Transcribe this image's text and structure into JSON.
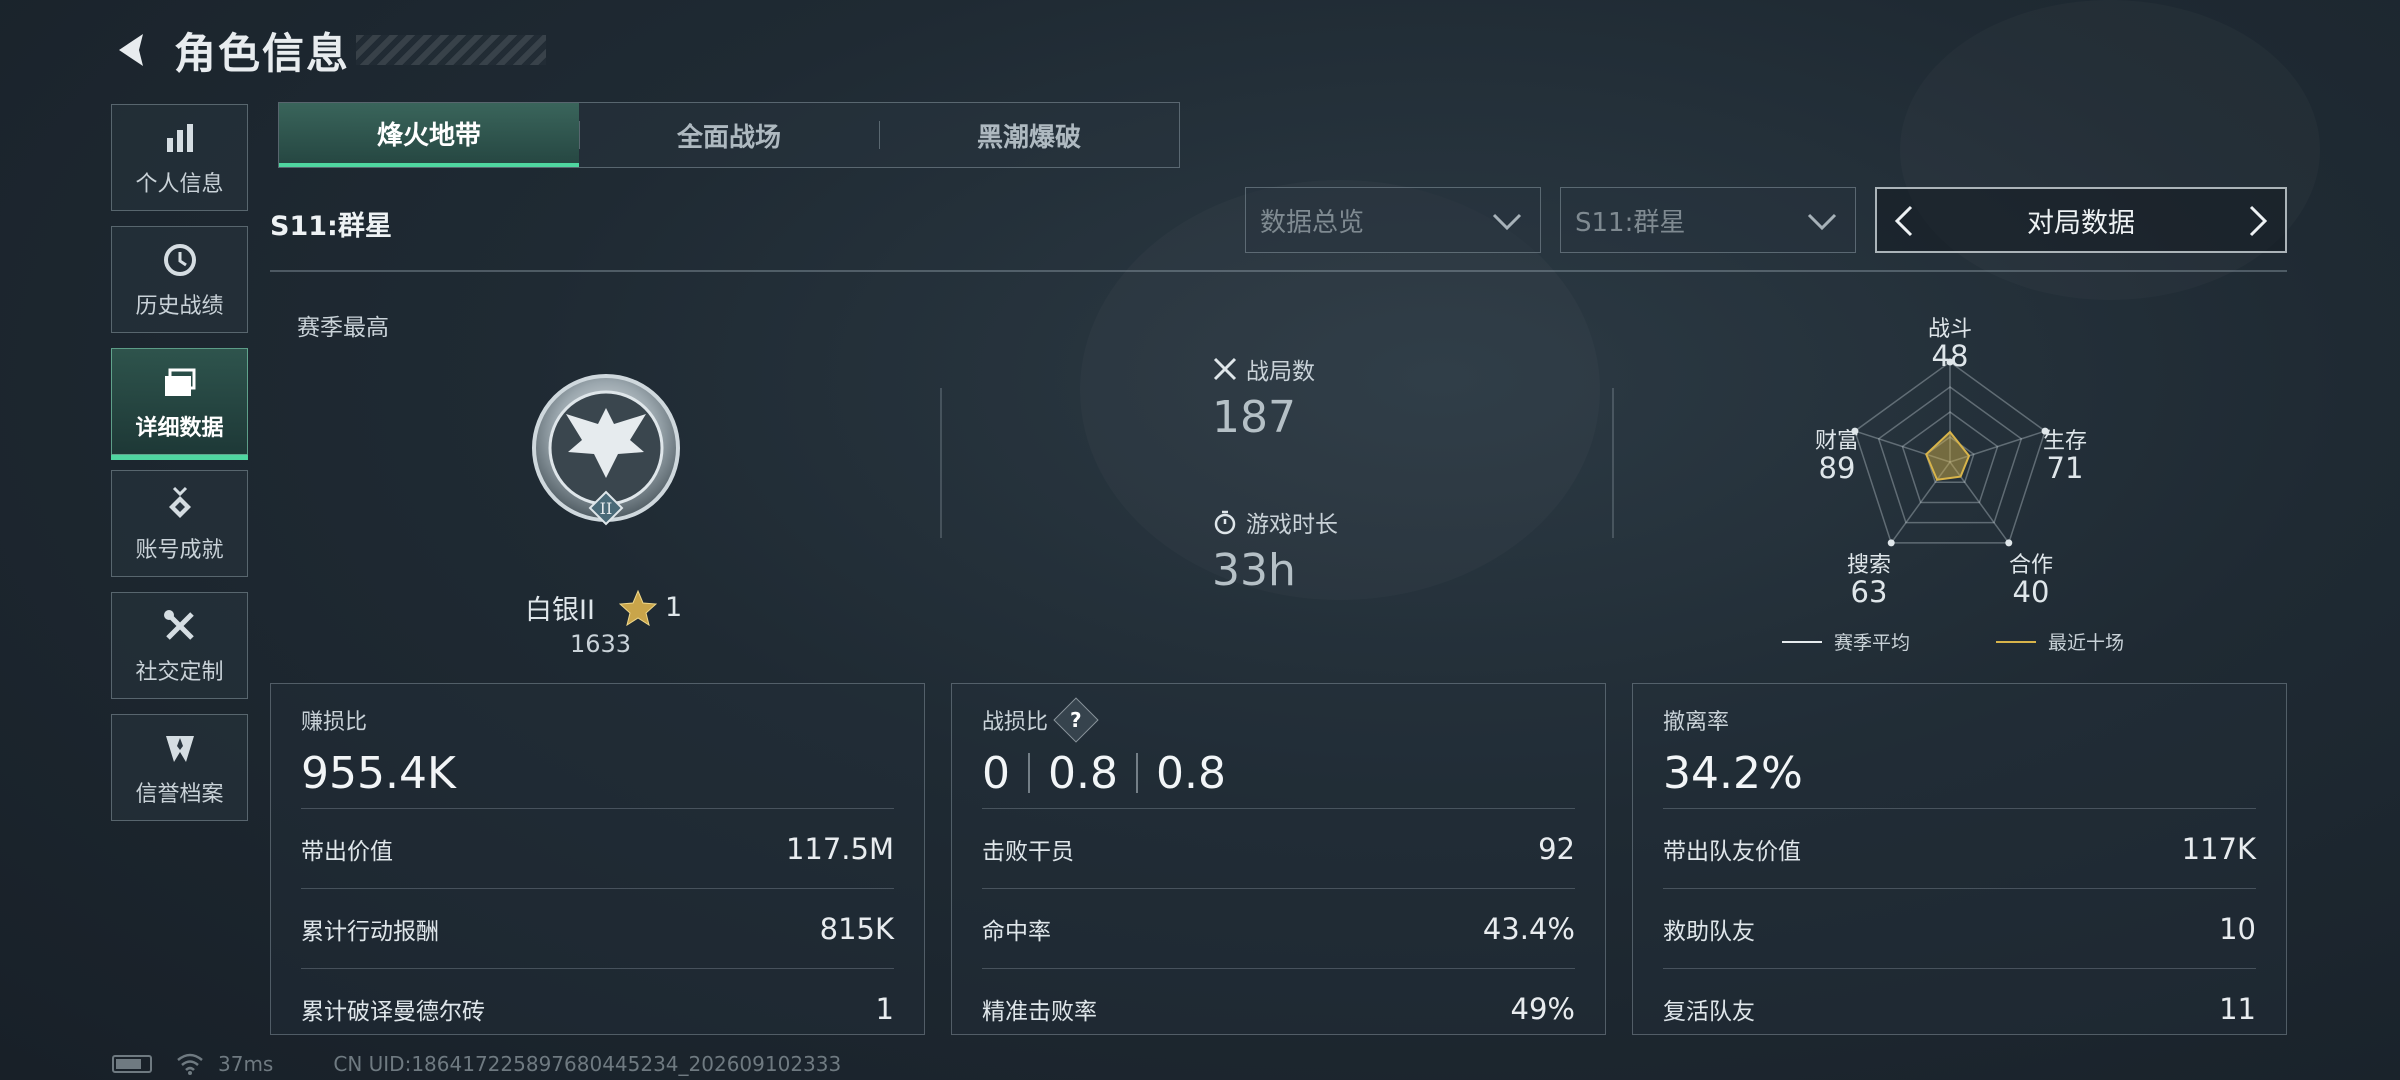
{
  "header": {
    "title": "角色信息"
  },
  "sidebar": {
    "items": [
      {
        "label": "个人信息",
        "icon": "bar-chart-icon",
        "active": false
      },
      {
        "label": "历史战绩",
        "icon": "history-clock-icon",
        "active": false
      },
      {
        "label": "详细数据",
        "icon": "folder-icon",
        "active": true
      },
      {
        "label": "账号成就",
        "icon": "medal-icon",
        "active": false
      },
      {
        "label": "社交定制",
        "icon": "tools-icon",
        "active": false
      },
      {
        "label": "信誉档案",
        "icon": "shield-emblem-icon",
        "active": false
      }
    ]
  },
  "tabs": [
    {
      "label": "烽火地带",
      "active": true
    },
    {
      "label": "全面战场",
      "active": false
    },
    {
      "label": "黑潮爆破",
      "active": false
    }
  ],
  "season_label": "S11:群星",
  "filters": {
    "overview_dropdown": "数据总览",
    "season_dropdown": "S11:群星",
    "switcher_label": "对局数据"
  },
  "rank": {
    "section_label": "赛季最高",
    "tier": "白银II",
    "stars": "1",
    "score": "1633",
    "emblem_numeral": "II"
  },
  "stats": {
    "matches_label": "战局数",
    "matches_value": "187",
    "playtime_label": "游戏时长",
    "playtime_value": "33h"
  },
  "radar": {
    "axes": [
      {
        "label": "战斗",
        "value": "48",
        "season_avg": 48,
        "recent": 30
      },
      {
        "label": "生存",
        "value": "71",
        "season_avg": 71,
        "recent": 20
      },
      {
        "label": "合作",
        "value": "40",
        "season_avg": 40,
        "recent": 18
      },
      {
        "label": "搜索",
        "value": "63",
        "season_avg": 63,
        "recent": 22
      },
      {
        "label": "财富",
        "value": "89",
        "season_avg": 89,
        "recent": 25
      }
    ],
    "legend": [
      {
        "label": "赛季平均",
        "color": "#e6ebee"
      },
      {
        "label": "最近十场",
        "color": "#d8b44a"
      }
    ]
  },
  "cards": {
    "profit": {
      "title": "赚损比",
      "value": "955.4K",
      "rows": [
        {
          "label": "带出价值",
          "value": "117.5M"
        },
        {
          "label": "累计行动报酬",
          "value": "815K"
        },
        {
          "label": "累计破译曼德尔砖",
          "value": "1"
        }
      ]
    },
    "kd": {
      "title": "战损比",
      "help": "?",
      "values": [
        "0",
        "0.8",
        "0.8"
      ],
      "rows": [
        {
          "label": "击败干员",
          "value": "92"
        },
        {
          "label": "命中率",
          "value": "43.4%"
        },
        {
          "label": "精准击败率",
          "value": "49%"
        }
      ]
    },
    "extract": {
      "title": "撤离率",
      "value": "34.2%",
      "rows": [
        {
          "label": "带出队友价值",
          "value": "117K"
        },
        {
          "label": "救助队友",
          "value": "10"
        },
        {
          "label": "复活队友",
          "value": "11"
        }
      ]
    }
  },
  "footer": {
    "ping": "37ms",
    "uid": "CN UID:186417225897680445234_202609102333"
  },
  "colors": {
    "accent": "#4fd6a0",
    "gold": "#d8b44a"
  }
}
